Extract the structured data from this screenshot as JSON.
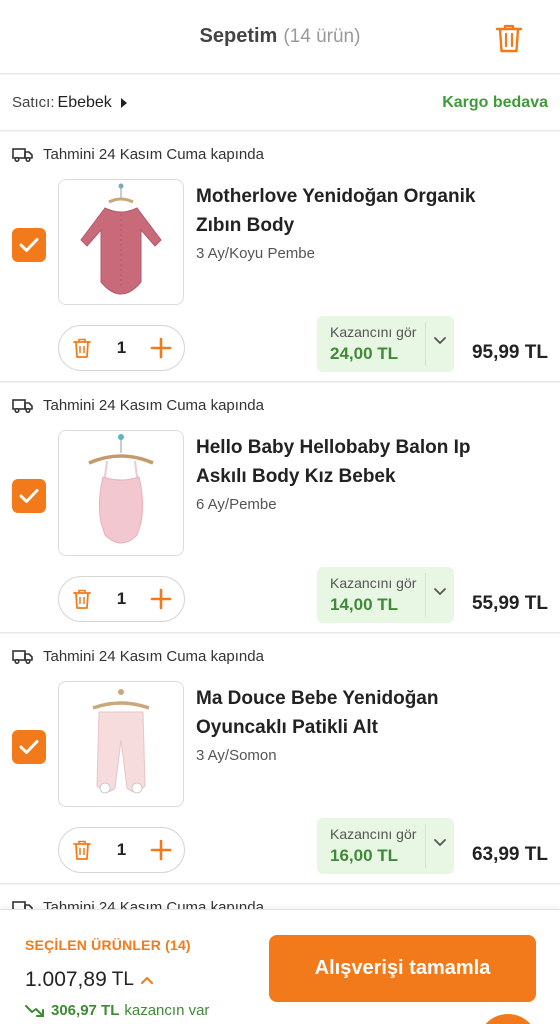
{
  "header": {
    "title": "Sepetim",
    "count": "(14 ürün)",
    "trash_icon": "trash-icon"
  },
  "seller": {
    "label": "Satıcı:",
    "name": "Ebebek",
    "shipping": "Kargo bedava"
  },
  "items": [
    {
      "delivery": "Tahmini 24 Kasım Cuma kapında",
      "title": "Motherlove Yenidoğan Organik Zıbın Body",
      "variant": "3 Ay/Koyu Pembe",
      "qty": "1",
      "earn_label": "Kazancını gör",
      "earn_value": "24,00 TL",
      "price": "95,99 TL",
      "checked": true,
      "image_color": "#c86a7a"
    },
    {
      "delivery": "Tahmini 24 Kasım Cuma kapında",
      "title": "Hello Baby Hellobaby Balon Ip Askılı Body Kız Bebek",
      "variant": "6 Ay/Pembe",
      "qty": "1",
      "earn_label": "Kazancını gör",
      "earn_value": "14,00 TL",
      "price": "55,99 TL",
      "checked": true,
      "image_color": "#f3c7cf"
    },
    {
      "delivery": "Tahmini 24 Kasım Cuma kapında",
      "title": "Ma Douce Bebe Yenidoğan Oyuncaklı Patikli Alt",
      "variant": "3 Ay/Somon",
      "qty": "1",
      "earn_label": "Kazancını gör",
      "earn_value": "16,00 TL",
      "price": "63,99 TL",
      "checked": true,
      "image_color": "#f6dcdc"
    }
  ],
  "peek_delivery": "Tahmini 24 Kasım Cuma kapında",
  "footer": {
    "selected_label": "SEÇİLEN ÜRÜNLER (14)",
    "total_value": "1.007,89",
    "total_currency": "TL",
    "saved_value": "306,97 TL",
    "saved_text": "kazancın var",
    "checkout_label": "Alışverişi tamamla"
  },
  "colors": {
    "accent": "#f27a1a",
    "success": "#3f8a36",
    "earn_bg": "#e8f6e4"
  }
}
